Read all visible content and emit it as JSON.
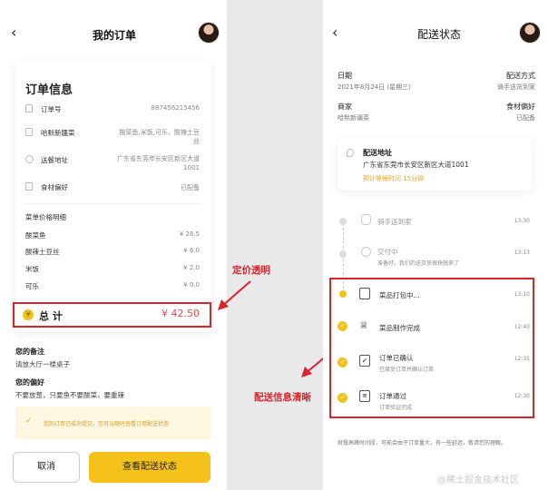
{
  "left": {
    "header": {
      "title": "我的订单"
    },
    "order_info": {
      "title": "订单信息",
      "rows": [
        {
          "label": "订单号",
          "value": "887456215456"
        },
        {
          "label": "哈默新疆菜",
          "value": "酸菜鱼,米饭,可乐、酸辣土豆丝"
        },
        {
          "label": "送餐地址",
          "value": "广东省东莞市长安区新区大道1001"
        },
        {
          "label": "食材偏好",
          "value": "已配备"
        }
      ],
      "price_title": "菜单价格明细",
      "prices": [
        {
          "name": "酸菜鱼",
          "price": "¥ 28.5"
        },
        {
          "name": "酸辣土豆丝",
          "price": "¥ 6.0"
        },
        {
          "name": "米饭",
          "price": "¥ 2.0"
        },
        {
          "name": "可乐",
          "price": "¥ 0.0"
        }
      ],
      "total_label": "总 计",
      "total_value": "¥ 42.50"
    },
    "remark": {
      "title": "您的备注",
      "text": "请放大厅一楼桌子"
    },
    "preference": {
      "title": "您的偏好",
      "text": "不要放葱，只要鱼不要酸菜，要重辣"
    },
    "notice": "您的订单已成功提交，您可以随时查看订单配送状态",
    "buttons": {
      "cancel": "取消",
      "view": "查看配送状态"
    }
  },
  "annotations": {
    "left": "定价透明",
    "right": "配送信息清晰"
  },
  "right": {
    "header": {
      "title": "配送状态"
    },
    "info": {
      "date_label": "日期",
      "date_value": "2021年8月24日 (星期三)",
      "method_label": "配送方式",
      "method_value": "骑手送货到家",
      "shop_label": "商家",
      "shop_value": "哈默新疆菜",
      "pref_label": "食材偏好",
      "pref_value": "已配备"
    },
    "address": {
      "label": "配送地址",
      "value": "广东省东莞市长安区新区大道1001",
      "eta": "预计等候时间 15分钟"
    },
    "steps": [
      {
        "title": "骑手送到家",
        "sub": "",
        "time": "13:30"
      },
      {
        "title": "交付中",
        "sub": "准备好，我们的送货员很快就来了",
        "time": "13:13"
      },
      {
        "title": "菜品打包中...",
        "sub": "",
        "time": "13:10"
      },
      {
        "title": "菜品制作完成",
        "sub": "",
        "time": "12:40"
      },
      {
        "title": "订单已确认",
        "sub": "已接受订单并确认订单",
        "time": "12:35"
      },
      {
        "title": "订单通过",
        "sub": "订单验证完成",
        "time": "12:30"
      }
    ],
    "footer": "就餐高峰时间段，可能会由于订单量大，有一些延迟，敬请您的理解。"
  },
  "watermark": "@稀土掘金技术社区",
  "colors": {
    "accent": "#f4c21a",
    "red": "#d9242a",
    "price_red": "#e8474a"
  }
}
